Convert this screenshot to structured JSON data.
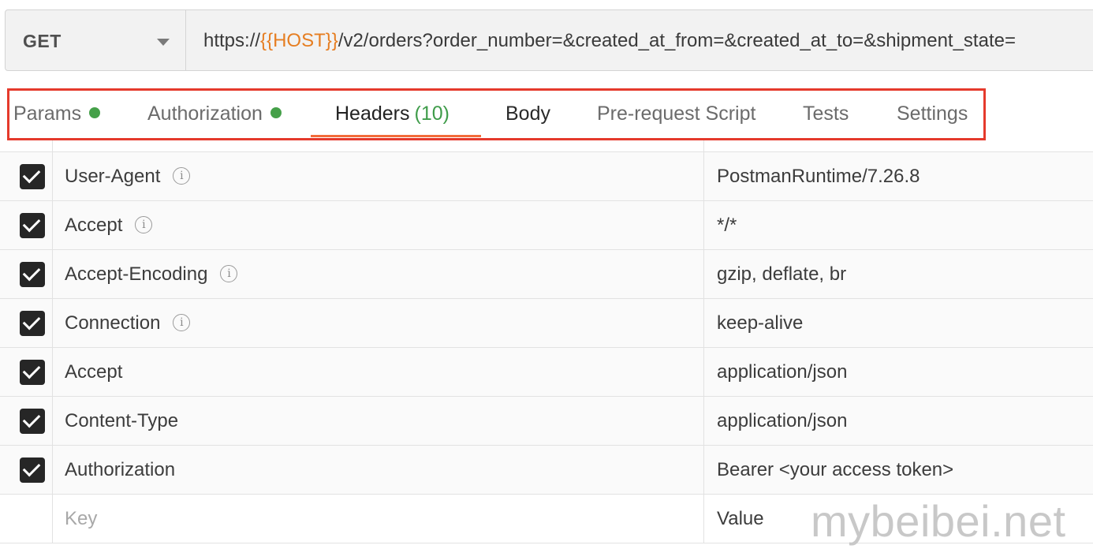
{
  "request": {
    "method": "GET",
    "url_prefix": "https://",
    "url_var": "{{HOST}}",
    "url_suffix": "/v2/orders?order_number=&created_at_from=&created_at_to=&shipment_state="
  },
  "tabs": [
    {
      "label": "Params",
      "dot": true
    },
    {
      "label": "Authorization",
      "dot": true
    },
    {
      "label": "Headers",
      "count": "(10)",
      "active": true
    },
    {
      "label": "Body"
    },
    {
      "label": "Pre-request Script"
    },
    {
      "label": "Tests"
    },
    {
      "label": "Settings"
    }
  ],
  "headers": [
    {
      "key": "User-Agent",
      "value": "PostmanRuntime/7.26.8",
      "info": true,
      "checked": true
    },
    {
      "key": "Accept",
      "value": "*/*",
      "info": true,
      "checked": true
    },
    {
      "key": "Accept-Encoding",
      "value": "gzip, deflate, br",
      "info": true,
      "checked": true
    },
    {
      "key": "Connection",
      "value": "keep-alive",
      "info": true,
      "checked": true
    },
    {
      "key": "Accept",
      "value": "application/json",
      "checked": true
    },
    {
      "key": "Content-Type",
      "value": "application/json",
      "checked": true
    },
    {
      "key": "Authorization",
      "value": "Bearer <your access token>",
      "checked": true
    }
  ],
  "new_row": {
    "key_placeholder": "Key",
    "value_placeholder": "Value"
  },
  "watermark": "mybeibei.net",
  "colors": {
    "highlight": "#e53a2c",
    "active_underline": "#f26b3a",
    "url_var": "#e67e22",
    "dot": "#45a049"
  }
}
